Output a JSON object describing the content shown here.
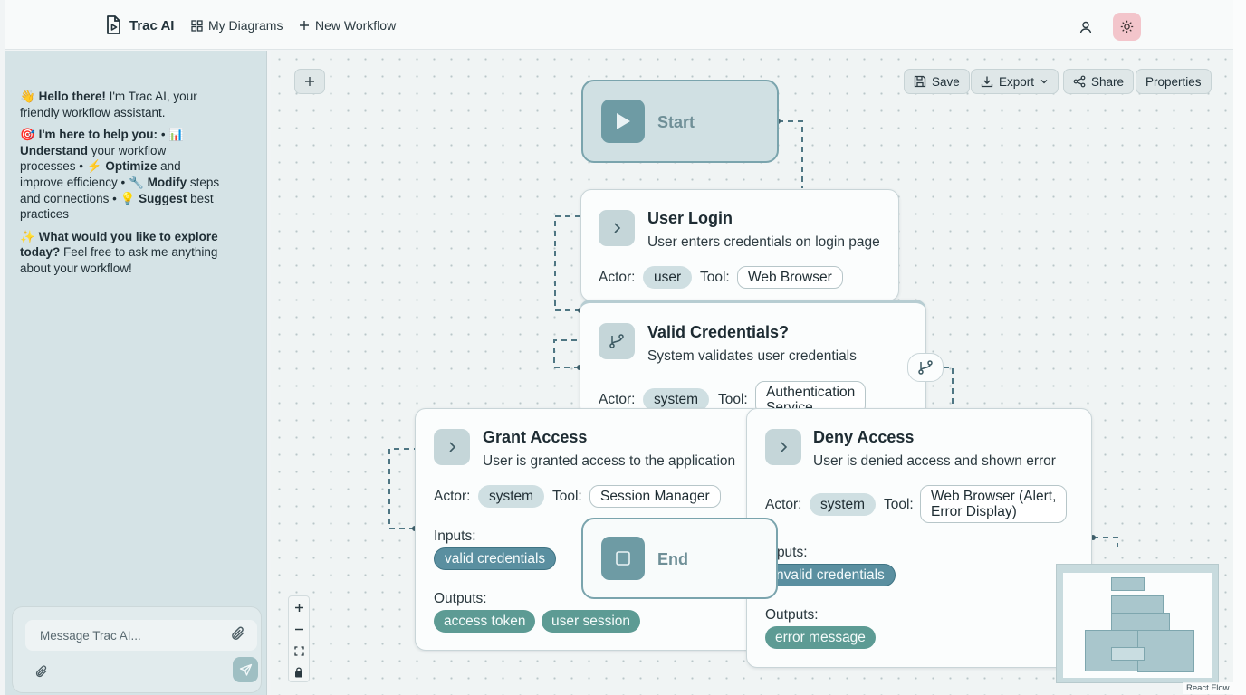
{
  "nav": {
    "brand": "Trac AI",
    "my_diagrams": "My Diagrams",
    "new_workflow": "New Workflow"
  },
  "chat": {
    "greeting_bold": "Hello there!",
    "greeting_rest": " I'm Trac AI, your friendly workflow assistant.",
    "help_bold": "I'm here to help you:",
    "understand_bold": "Understand",
    "understand_rest": " your workflow processes • ",
    "optimize_bold": "Optimize",
    "optimize_rest": " and improve efficiency • ",
    "modify_bold": "Modify",
    "modify_rest": " steps and connections • ",
    "suggest_bold": "Suggest",
    "suggest_rest": " best practices",
    "explore_bold": "What would you like to explore today?",
    "explore_rest": " Feel free to ask me anything about your workflow!",
    "input_placeholder": "Message Trac AI..."
  },
  "toolbar": {
    "save": "Save",
    "export": "Export",
    "share": "Share",
    "properties": "Properties"
  },
  "labels": {
    "actor": "Actor:",
    "tool": "Tool:",
    "inputs": "Inputs:",
    "outputs": "Outputs:",
    "inputs_clipped": "puts:"
  },
  "nodes": {
    "start": {
      "label": "Start"
    },
    "end": {
      "label": "End"
    },
    "user_login": {
      "title": "User Login",
      "description": "User enters credentials on login page",
      "actor": "user",
      "tool": "Web Browser"
    },
    "valid_credentials": {
      "title": "Valid Credentials?",
      "description": "System validates user credentials",
      "actor": "system",
      "tool_line1": "Authentication",
      "tool_line2": "Service"
    },
    "grant_access": {
      "title": "Grant Access",
      "description": "User is granted access to the application",
      "actor": "system",
      "tool": "Session Manager",
      "inputs": [
        "valid credentials"
      ],
      "outputs": [
        "access token",
        "user session"
      ]
    },
    "deny_access": {
      "title": "Deny Access",
      "description": "User is denied access and shown error",
      "actor": "system",
      "tool_line1": "Web Browser (Alert,",
      "tool_line2": "Error Display)",
      "inputs": [
        "nvalid credentials"
      ],
      "outputs": [
        "error message"
      ]
    }
  },
  "attribution": "React Flow",
  "colors": {
    "canvas_bg": "#f0f4f4",
    "chat_bg": "#d5e3e6",
    "accent": "#6e9ba4",
    "theme_button": "#f3c5cb",
    "input_chip": "#5a8fa0",
    "output_chip": "#5d9b94"
  }
}
